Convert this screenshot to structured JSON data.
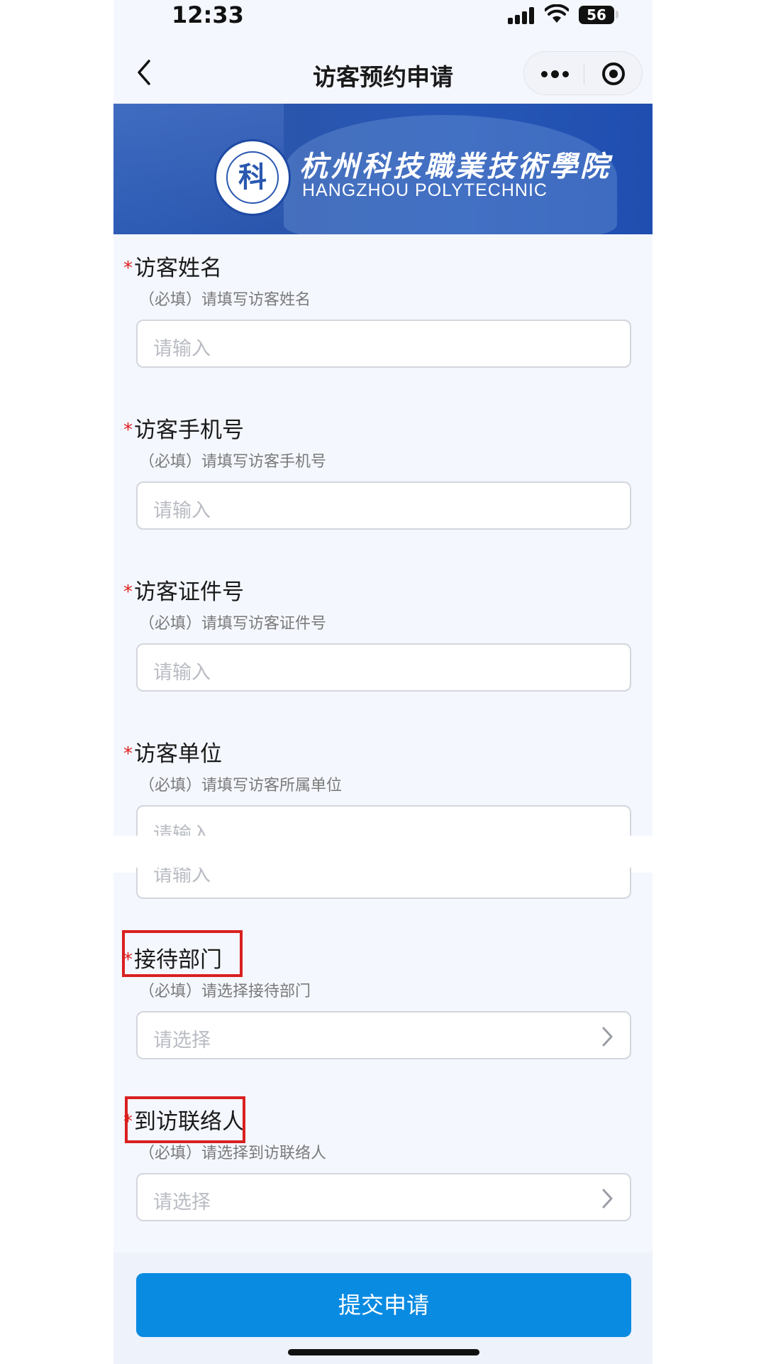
{
  "status_bar": {
    "time": "12:33",
    "battery": "56"
  },
  "nav": {
    "title": "访客预约申请"
  },
  "banner": {
    "school_name_cn": "杭州科技職業技術學院",
    "school_name_en": "HANGZHOU  POLYTECHNIC",
    "logo_char": "科"
  },
  "form": {
    "fields": [
      {
        "label": "访客姓名",
        "hint": "（必填）请填写访客姓名",
        "placeholder": "请输入",
        "type": "input"
      },
      {
        "label": "访客手机号",
        "hint": "（必填）请填写访客手机号",
        "placeholder": "请输入",
        "type": "input"
      },
      {
        "label": "访客证件号",
        "hint": "（必填）请填写访客证件号",
        "placeholder": "请输入",
        "type": "input"
      },
      {
        "label": "访客单位",
        "hint": "（必填）请填写访客所属单位",
        "placeholder": "请输入",
        "type": "input"
      },
      {
        "label": "接待部门",
        "hint": "（必填）请选择接待部门",
        "placeholder": "请选择",
        "type": "select"
      },
      {
        "label": "到访联络人",
        "hint": "（必填）请选择到访联络人",
        "placeholder": "请选择",
        "type": "select"
      }
    ],
    "required_mark": "*",
    "ghost_placeholder": "请输入"
  },
  "submit": {
    "label": "提交申请"
  },
  "colors": {
    "accent": "#0a8be2",
    "required": "#e02020",
    "highlight": "#d92020",
    "banner": "#2757b6"
  }
}
